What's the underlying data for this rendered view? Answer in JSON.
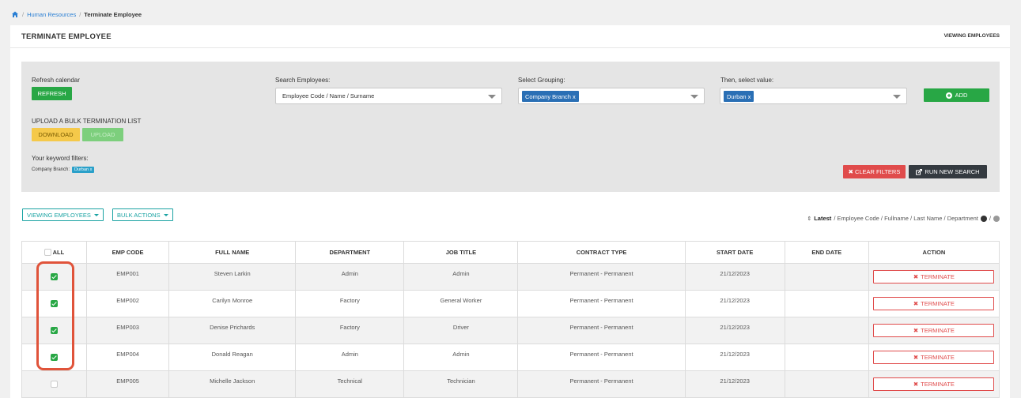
{
  "breadcrumb": {
    "link": "Human Resources",
    "current": "Terminate Employee"
  },
  "header": {
    "title": "TERMINATE EMPLOYEE",
    "right_label": "VIEWING EMPLOYEES"
  },
  "filters": {
    "refresh_label": "Refresh calendar",
    "refresh_button": "REFRESH",
    "search_label": "Search Employees:",
    "search_value": "Employee Code / Name / Surname",
    "grouping_label": "Select Grouping:",
    "grouping_tag": "Company Branch x",
    "value_label": "Then, select value:",
    "value_tag": "Durban x",
    "add_button": "ADD",
    "bulk_label": "UPLOAD A BULK TERMINATION LIST",
    "download_button": "DOWNLOAD",
    "upload_button": "UPLOAD",
    "keyword_label": "Your keyword filters:",
    "keyword_key": "Company Branch:",
    "keyword_chip": "Durban x",
    "clear_button": "CLEAR FILTERS",
    "run_button": "RUN NEW SEARCH"
  },
  "toolbar": {
    "viewing_button": "VIEWING EMPLOYEES",
    "bulk_button": "BULK ACTIONS",
    "sort_active": "Latest",
    "sort_options": "/ Employee Code / Fullname / Last Name / Department",
    "sort_tail": "/"
  },
  "table": {
    "columns": [
      "ALL",
      "EMP CODE",
      "FULL NAME",
      "DEPARTMENT",
      "JOB TITLE",
      "CONTRACT TYPE",
      "START DATE",
      "END DATE",
      "ACTION"
    ],
    "rows": [
      {
        "checked": true,
        "code": "EMP001",
        "name": "Steven Larkin",
        "department": "Admin",
        "job": "Admin",
        "contract": "Permanent - Permanent",
        "start": "21/12/2023",
        "end": "",
        "action": "TERMINATE"
      },
      {
        "checked": true,
        "code": "EMP002",
        "name": "Carilyn Monroe",
        "department": "Factory",
        "job": "General Worker",
        "contract": "Permanent - Permanent",
        "start": "21/12/2023",
        "end": "",
        "action": "TERMINATE"
      },
      {
        "checked": true,
        "code": "EMP003",
        "name": "Denise Prichards",
        "department": "Factory",
        "job": "Driver",
        "contract": "Permanent - Permanent",
        "start": "21/12/2023",
        "end": "",
        "action": "TERMINATE"
      },
      {
        "checked": true,
        "code": "EMP004",
        "name": "Donald Reagan",
        "department": "Admin",
        "job": "Admin",
        "contract": "Permanent - Permanent",
        "start": "21/12/2023",
        "end": "",
        "action": "TERMINATE"
      },
      {
        "checked": false,
        "code": "EMP005",
        "name": "Michelle Jackson",
        "department": "Technical",
        "job": "Technician",
        "contract": "Permanent - Permanent",
        "start": "21/12/2023",
        "end": "",
        "action": "TERMINATE"
      }
    ]
  },
  "colors": {
    "green": "#28a745",
    "red": "#e04b4b",
    "teal": "#1aa3a3",
    "blue": "#2a6fb5",
    "highlight": "#e0533a"
  }
}
